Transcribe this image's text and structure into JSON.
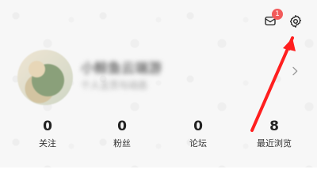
{
  "header": {
    "messages_icon": "message-icon",
    "messages_badge": "1",
    "settings_icon": "gear-icon"
  },
  "profile": {
    "name": "小鲸鱼云端游",
    "subline": "个人主页与动态",
    "chevron_icon": "chevron-right-icon"
  },
  "stats": [
    {
      "value": "0",
      "label": "关注"
    },
    {
      "value": "0",
      "label": "粉丝"
    },
    {
      "value": "0",
      "label": "论坛"
    },
    {
      "value": "8",
      "label": "最近浏览"
    }
  ],
  "colors": {
    "badge": "#f25b5b",
    "arrow": "#ff1f1f",
    "background": "#f7f7f7"
  }
}
